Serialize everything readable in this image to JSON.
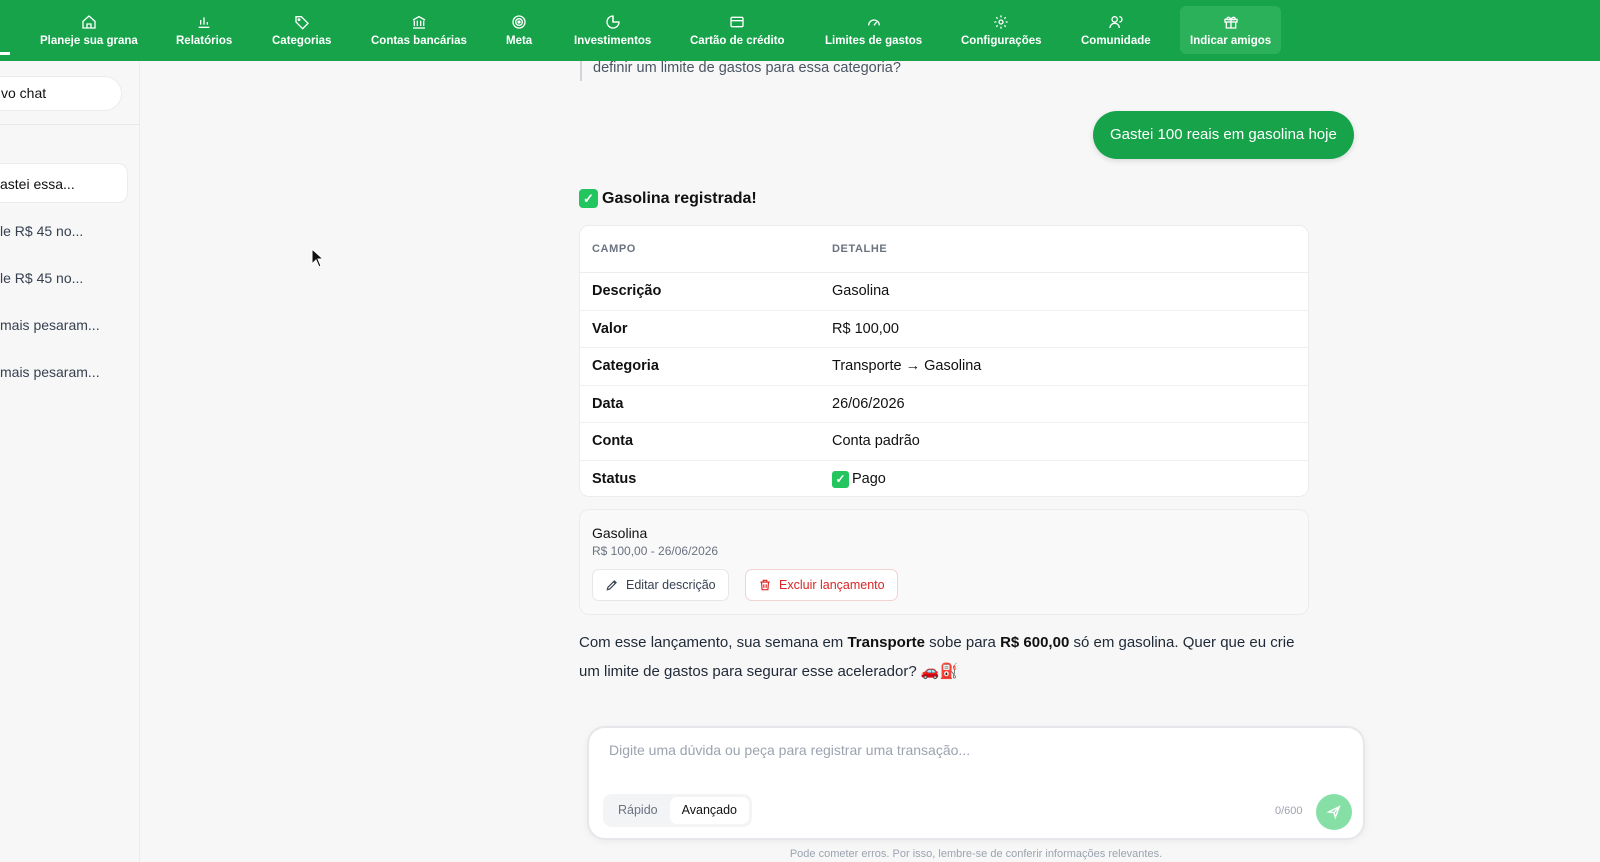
{
  "nav": {
    "items": [
      {
        "label": "Planeje sua grana",
        "icon": "home-icon"
      },
      {
        "label": "Relatórios",
        "icon": "bar-chart-icon"
      },
      {
        "label": "Categorias",
        "icon": "tag-icon"
      },
      {
        "label": "Contas bancárias",
        "icon": "bank-icon"
      },
      {
        "label": "Meta",
        "icon": "target-icon"
      },
      {
        "label": "Investimentos",
        "icon": "pie-chart-icon"
      },
      {
        "label": "Cartão de crédito",
        "icon": "credit-card-icon"
      },
      {
        "label": "Limites de gastos",
        "icon": "gauge-icon"
      },
      {
        "label": "Configurações",
        "icon": "gear-icon"
      },
      {
        "label": "Comunidade",
        "icon": "users-icon"
      },
      {
        "label": "Indicar amigos",
        "icon": "gift-icon"
      }
    ]
  },
  "sidebar": {
    "new_chat_label": "vo chat",
    "items": [
      {
        "label": "astei essa..."
      },
      {
        "label": "le R$ 45 no..."
      },
      {
        "label": "le R$ 45 no..."
      },
      {
        "label": " mais pesaram..."
      },
      {
        "label": " mais pesaram..."
      }
    ]
  },
  "chat": {
    "previous_text": "definir um limite de gastos para essa categoria?",
    "user_message": "Gastei 100 reais em gasolina hoje",
    "reply_title_emoji": "✓",
    "reply_title": "Gasolina registrada!",
    "table": {
      "headers": [
        "CAMPO",
        "DETALHE"
      ],
      "rows": [
        {
          "field": "Descrição",
          "value": "Gasolina"
        },
        {
          "field": "Valor",
          "value": "R$ 100,00"
        },
        {
          "field": "Categoria",
          "value": "Transporte → Gasolina"
        },
        {
          "field": "Data",
          "value": "26/06/2026"
        },
        {
          "field": "Conta",
          "value": "Conta padrão"
        },
        {
          "field": "Status",
          "value": "Pago"
        }
      ]
    },
    "entry": {
      "name": "Gasolina",
      "meta": "R$ 100,00 - 26/06/2026",
      "edit_label": "Editar descrição",
      "delete_label": "Excluir lançamento"
    },
    "summary": {
      "part1": "Com esse lançamento, sua semana em ",
      "bold1": "Transporte",
      "part2": " sobe para ",
      "bold2": "R$ 600,00",
      "part3": " só em gasolina. Quer que eu crie um limite de gastos para segurar esse acelerador? 🚗⛽"
    }
  },
  "composer": {
    "placeholder": "Digite uma dúvida ou peça para registrar uma transação...",
    "value": "",
    "mode_fast": "Rápido",
    "mode_advanced": "Avançado",
    "char_count": "0/600",
    "disclaimer": "Pode cometer erros. Por isso, lembre-se de conferir informações relevantes."
  },
  "colors": {
    "brand": "#16a34a",
    "danger": "#dc2626",
    "send_disabled": "#86e0a6"
  }
}
